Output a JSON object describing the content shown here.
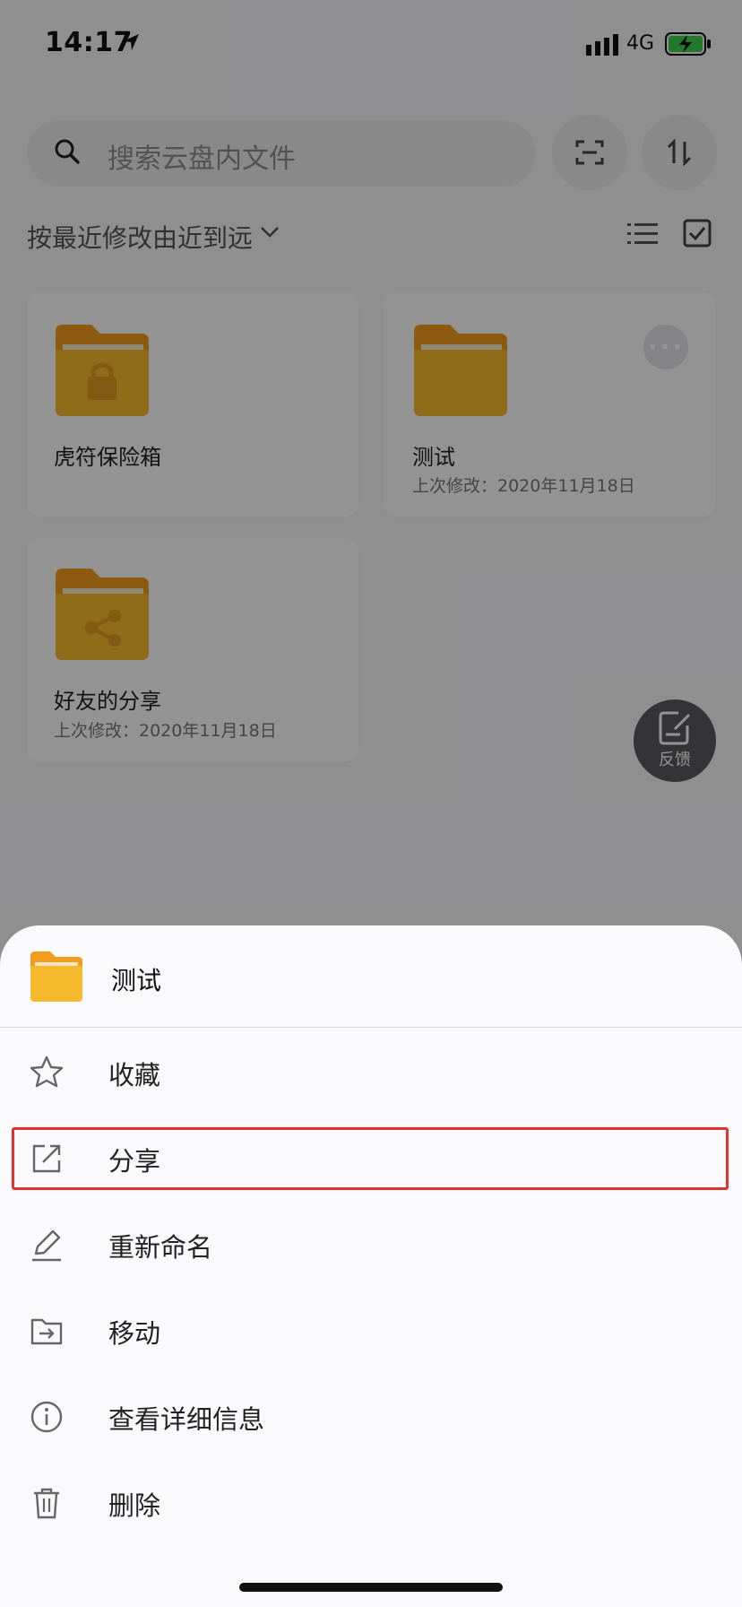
{
  "status_bar": {
    "time": "14:17",
    "network": "4G"
  },
  "search": {
    "placeholder": "搜索云盘内文件"
  },
  "sort": {
    "label": "按最近修改由近到远"
  },
  "files": [
    {
      "name": "虎符保险箱",
      "subtitle": "",
      "icon": "lock-folder-icon"
    },
    {
      "name": "测试",
      "subtitle": "上次修改：2020年11月18日",
      "icon": "folder-icon"
    },
    {
      "name": "好友的分享",
      "subtitle": "上次修改：2020年11月18日",
      "icon": "share-folder-icon"
    }
  ],
  "feedback": {
    "label": "反馈"
  },
  "action_sheet": {
    "title": "测试",
    "items": [
      {
        "label": "收藏",
        "icon": "star-icon"
      },
      {
        "label": "分享",
        "icon": "share-icon"
      },
      {
        "label": "重新命名",
        "icon": "pencil-icon"
      },
      {
        "label": "移动",
        "icon": "move-folder-icon"
      },
      {
        "label": "查看详细信息",
        "icon": "info-icon"
      },
      {
        "label": "删除",
        "icon": "trash-icon"
      }
    ]
  },
  "colors": {
    "folder": "#f7b92d",
    "folder_back": "#f39c1f",
    "highlight": "#e0332f",
    "overlay": "rgba(0,0,0,0.42)"
  }
}
